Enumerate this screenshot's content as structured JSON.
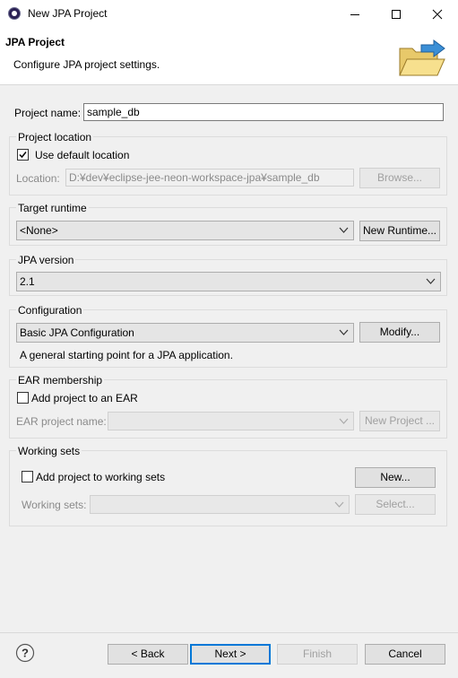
{
  "window": {
    "title": "New JPA Project"
  },
  "header": {
    "title": "JPA Project",
    "description": "Configure JPA project settings."
  },
  "project_name": {
    "label": "Project name:",
    "value": "sample_db"
  },
  "project_location": {
    "group_label": "Project location",
    "use_default_label": "Use default location",
    "use_default_checked": true,
    "location_label": "Location:",
    "location_value": "D:¥dev¥eclipse-jee-neon-workspace-jpa¥sample_db",
    "browse_label": "Browse..."
  },
  "target_runtime": {
    "group_label": "Target runtime",
    "selected": "<None>",
    "new_runtime_label": "New Runtime..."
  },
  "jpa_version": {
    "group_label": "JPA version",
    "selected": "2.1"
  },
  "configuration": {
    "group_label": "Configuration",
    "selected": "Basic JPA Configuration",
    "modify_label": "Modify...",
    "description": "A general starting point for a JPA application."
  },
  "ear_membership": {
    "group_label": "EAR membership",
    "add_label": "Add project to an EAR",
    "add_checked": false,
    "ear_project_label": "EAR project name:",
    "ear_project_value": "",
    "new_project_label": "New Project ..."
  },
  "working_sets": {
    "group_label": "Working sets",
    "add_label": "Add project to working sets",
    "add_checked": false,
    "new_label": "New...",
    "sets_label": "Working sets:",
    "sets_value": "",
    "select_label": "Select..."
  },
  "footer": {
    "back_label": "< Back",
    "next_label": "Next >",
    "finish_label": "Finish",
    "cancel_label": "Cancel"
  },
  "icons": [
    "app-icon",
    "minimize-icon",
    "maximize-icon",
    "close-icon",
    "folder-wizard-icon",
    "checkmark-icon",
    "chevron-down-icon",
    "help-icon"
  ]
}
